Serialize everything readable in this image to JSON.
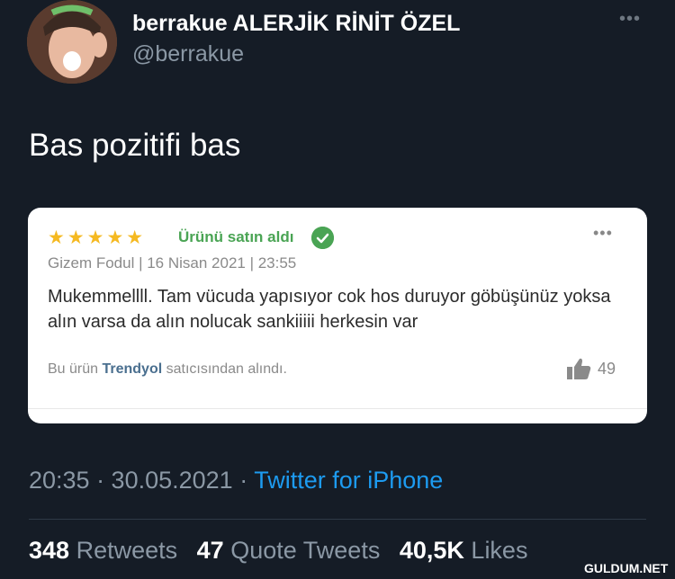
{
  "tweet": {
    "display_name": "berrakue ALERJİK RİNİT ÖZEL",
    "handle": "@berrakue",
    "more_icon": "more-horizontal-icon",
    "text": "Bas pozitifi bas",
    "timestamp": "20:35 · 30.05.2021 · ",
    "source": "Twitter for iPhone",
    "stats": {
      "retweets_count": "348",
      "retweets_label": "Retweets",
      "quotes_count": "47",
      "quotes_label": "Quote Tweets",
      "likes_count": "40,5K",
      "likes_label": "Likes"
    }
  },
  "review_card": {
    "stars": "★★★★★",
    "rating": 5,
    "verified_label": "Ürünü satın aldı",
    "meta": "Gizem Fodul | 16 Nisan 2021 | 23:55",
    "text": "Mukemmellll. Tam vücuda yapısıyor cok hos duruyor göbüşünüz yoksa alın varsa da alın nolucak sankiiiii herkesin var",
    "seller_prefix": "Bu ürün ",
    "seller_brand": "Trendyol",
    "seller_suffix": " satıcısından alındı.",
    "helpful_count": "49"
  },
  "watermark": "GULDUM.NET",
  "colors": {
    "background": "#151c26",
    "link": "#1d9bf0",
    "star": "#f5b921",
    "verified": "#4aa454"
  }
}
